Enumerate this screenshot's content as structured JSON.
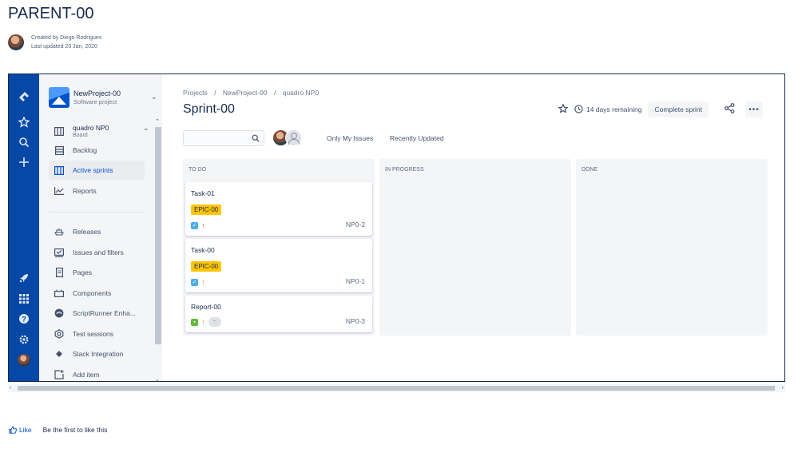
{
  "page": {
    "title": "PARENT-00",
    "created_by": "Created by Diego Rodrigues",
    "last_updated": "Last updated 20 Jan, 2020"
  },
  "global_nav": {
    "icons": [
      "jira-logo-icon",
      "star-icon",
      "search-icon",
      "plus-icon",
      "rocket-icon",
      "apps-grid-icon",
      "help-icon",
      "settings-icon",
      "user-avatar"
    ]
  },
  "project": {
    "name": "NewProject-00",
    "type": "Software project",
    "board_name": "quadro NP0",
    "board_type": "Board"
  },
  "sidebar": {
    "items": [
      {
        "label": "Backlog",
        "icon": "backlog-icon"
      },
      {
        "label": "Active sprints",
        "icon": "board-icon",
        "active": true
      },
      {
        "label": "Reports",
        "icon": "reports-icon"
      },
      {
        "label": "Releases",
        "icon": "ship-icon"
      },
      {
        "label": "Issues and filters",
        "icon": "issues-icon"
      },
      {
        "label": "Pages",
        "icon": "page-icon"
      },
      {
        "label": "Components",
        "icon": "components-icon"
      },
      {
        "label": "ScriptRunner Enha...",
        "icon": "scriptrunner-icon"
      },
      {
        "label": "Test sessions",
        "icon": "test-sessions-icon"
      },
      {
        "label": "Slack Integration",
        "icon": "slack-icon"
      },
      {
        "label": "Add item",
        "icon": "add-item-icon"
      }
    ]
  },
  "breadcrumb": [
    "Projects",
    "/",
    "NewProject-00",
    "/",
    "quadro NP0"
  ],
  "sprint": {
    "title": "Sprint-00",
    "remaining": "14 days remaining",
    "complete_label": "Complete sprint",
    "more_label": "•••"
  },
  "filters": {
    "only_my_issues": "Only My Issues",
    "recently_updated": "Recently Updated"
  },
  "columns": [
    {
      "title": "TO DO"
    },
    {
      "title": "IN PROGRESS"
    },
    {
      "title": "DONE"
    }
  ],
  "cards": [
    {
      "title": "Task-01",
      "epic": "EPIC-00",
      "key": "NP0-2",
      "type": "task",
      "type_color": "#4bade8",
      "priority": "highest",
      "priority_color": "#d04437"
    },
    {
      "title": "Task-00",
      "epic": "EPIC-00",
      "key": "NP0-1",
      "type": "task",
      "type_color": "#4bade8",
      "priority": "medium",
      "priority_color": "#ff7452"
    },
    {
      "title": "Report-00",
      "key": "NP0-3",
      "type": "story",
      "type_color": "#63ba3c",
      "priority": "medium",
      "priority_color": "#ff7452",
      "estimate": "-"
    }
  ],
  "footer": {
    "like_label": "Like",
    "like_text": "Be the first to like this"
  },
  "colors": {
    "nav_blue": "#0747a6",
    "link_blue": "#0052cc",
    "epic_yellow": "#ffc400"
  }
}
